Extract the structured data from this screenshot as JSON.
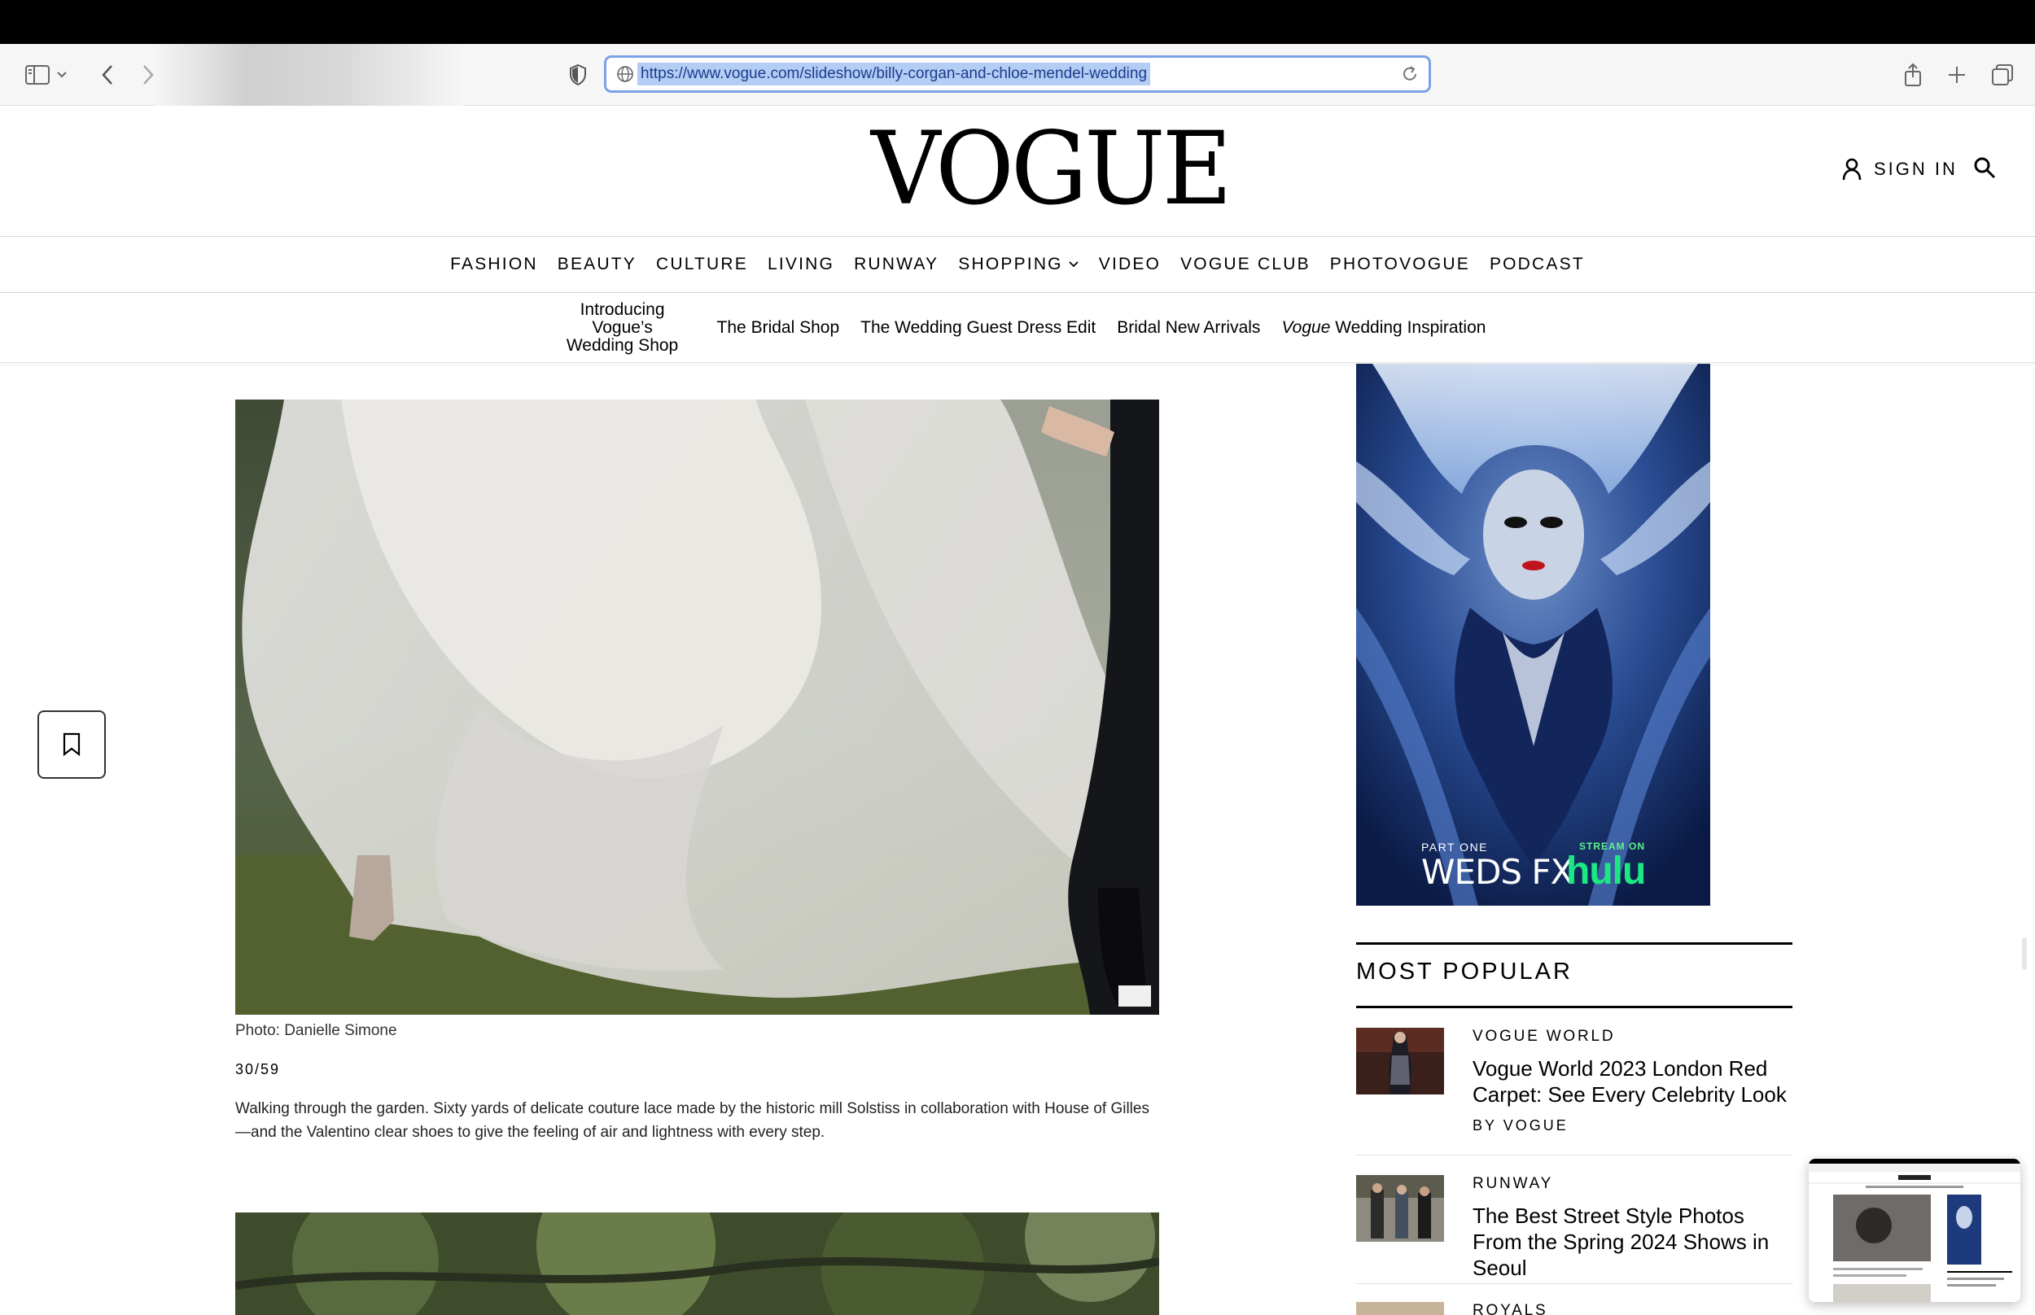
{
  "browser": {
    "url": "https://www.vogue.com/slideshow/billy-corgan-and-chloe-mendel-wedding"
  },
  "header": {
    "logo": "VOGUE",
    "sign_in": "SIGN IN"
  },
  "main_nav": [
    "FASHION",
    "BEAUTY",
    "CULTURE",
    "LIVING",
    "RUNWAY",
    "SHOPPING",
    "VIDEO",
    "VOGUE CLUB",
    "PHOTOVOGUE",
    "PODCAST"
  ],
  "sub_nav": {
    "item1_line1": "Introducing Vogue’s",
    "item1_line2": "Wedding Shop",
    "item2": "The Bridal Shop",
    "item3": "The Wedding Guest Dress Edit",
    "item4": "Bridal New Arrivals",
    "item5_italic": "Vogue",
    "item5_rest": " Wedding Inspiration"
  },
  "slide": {
    "credit": "Photo: Danielle Simone",
    "counter": "30/59",
    "caption": "Walking through the garden. Sixty yards of delicate couture lace made by the historic mill Solstiss in collaboration with House of Gilles—and the Valentino clear shoes to give the feeling of air and lightness with every step."
  },
  "ad": {
    "part": "PART ONE",
    "weds": "WEDS FX",
    "stream": "STREAM ON",
    "hulu": "hulu"
  },
  "most_popular": {
    "title": "MOST POPULAR",
    "items": [
      {
        "rubric": "VOGUE WORLD",
        "headline": "Vogue World 2023 London Red Carpet: See Every Celebrity Look",
        "byline": "BY VOGUE"
      },
      {
        "rubric": "RUNWAY",
        "headline": "The Best Street Style Photos From the Spring 2024 Shows in Seoul"
      },
      {
        "rubric": "ROYALS"
      }
    ]
  }
}
